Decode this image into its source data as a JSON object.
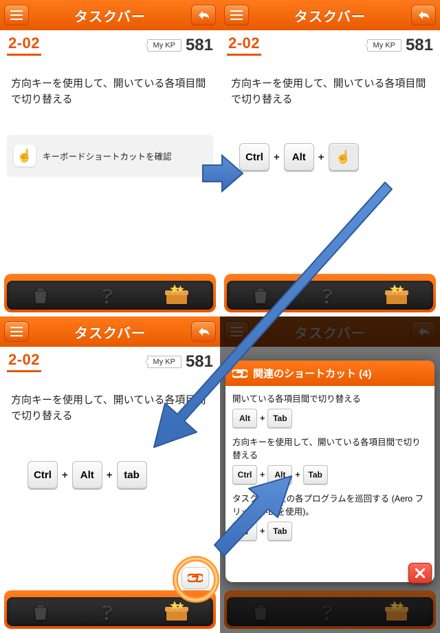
{
  "header": {
    "title": "タスクバー"
  },
  "meta": {
    "qnum": "2-02",
    "kp_label": "My KP",
    "kp_value": "581"
  },
  "desc": "方向キーを使用して、開いている各項目間で切り替える",
  "card": {
    "label": "キーボードショートカットを確認"
  },
  "keys": {
    "ctrl": "Ctrl",
    "alt": "Alt",
    "tab": "tab",
    "tab_uc": "Tab",
    "plus": "+"
  },
  "popup": {
    "title": "関連のショートカット (4)",
    "items": [
      {
        "text": "開いている各項目間で切り替える",
        "keys": [
          "Alt",
          "Tab"
        ]
      },
      {
        "text": "方向キーを使用して、開いている各項目間で切り替える",
        "keys": [
          "Ctrl",
          "Alt",
          "Tab"
        ]
      },
      {
        "text": "タスク バー上の各プログラムを巡回する (Aero フリップ 3-D を使用)。",
        "keys": [
          "⊞",
          "Tab"
        ]
      }
    ]
  }
}
